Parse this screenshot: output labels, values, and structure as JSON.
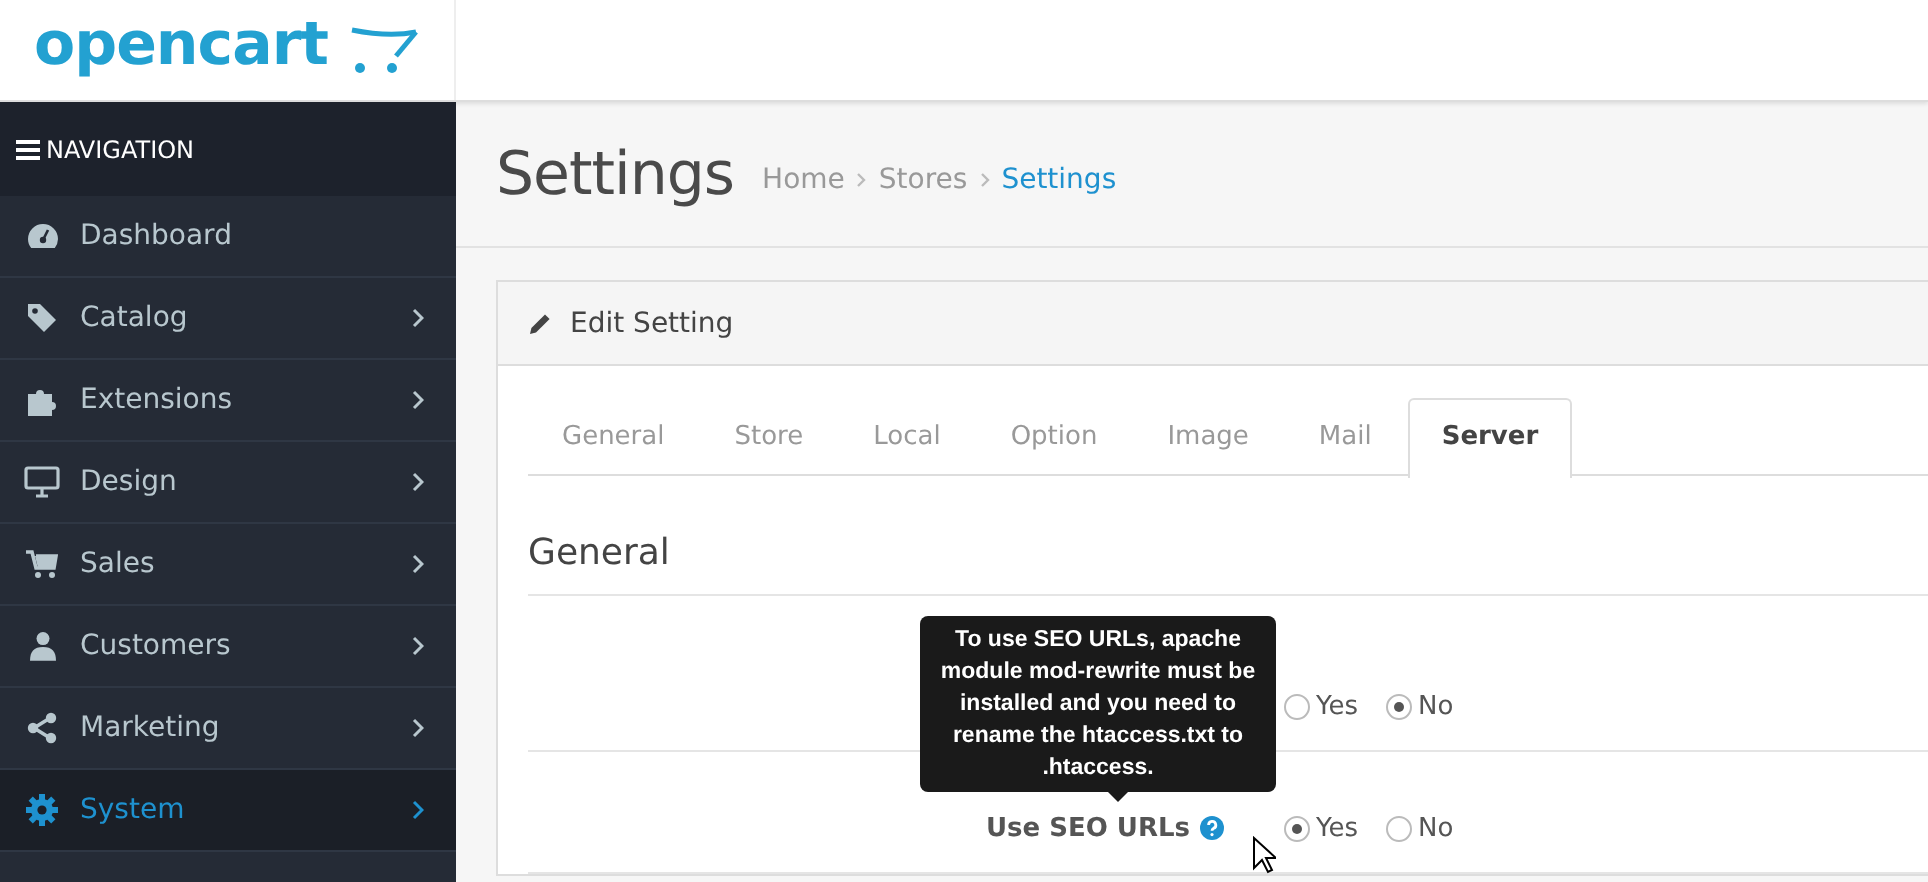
{
  "logo": {
    "text": "opencart"
  },
  "navigation": {
    "title": "NAVIGATION",
    "items": [
      {
        "label": "Dashboard",
        "has_submenu": false,
        "selected": false
      },
      {
        "label": "Catalog",
        "has_submenu": true,
        "selected": false
      },
      {
        "label": "Extensions",
        "has_submenu": true,
        "selected": false
      },
      {
        "label": "Design",
        "has_submenu": true,
        "selected": false
      },
      {
        "label": "Sales",
        "has_submenu": true,
        "selected": false
      },
      {
        "label": "Customers",
        "has_submenu": true,
        "selected": false
      },
      {
        "label": "Marketing",
        "has_submenu": true,
        "selected": false
      },
      {
        "label": "System",
        "has_submenu": true,
        "selected": true
      }
    ]
  },
  "page": {
    "title": "Settings",
    "breadcrumb": [
      {
        "label": "Home",
        "selected": false
      },
      {
        "label": "Stores",
        "selected": false
      },
      {
        "label": "Settings",
        "selected": true
      }
    ]
  },
  "panel": {
    "title": "Edit Setting",
    "tabs": [
      {
        "label": "General",
        "selected": false
      },
      {
        "label": "Store",
        "selected": false
      },
      {
        "label": "Local",
        "selected": false
      },
      {
        "label": "Option",
        "selected": false
      },
      {
        "label": "Image",
        "selected": false
      },
      {
        "label": "Mail",
        "selected": false
      },
      {
        "label": "Server",
        "selected": true
      }
    ],
    "section": "General",
    "rows": [
      {
        "options": [
          {
            "label": "Yes",
            "selected": false
          },
          {
            "label": "No",
            "selected": true
          }
        ]
      },
      {
        "label": "Use SEO URLs",
        "options": [
          {
            "label": "Yes",
            "selected": true
          },
          {
            "label": "No",
            "selected": false
          }
        ]
      }
    ],
    "tooltip": {
      "text": "To use SEO URLs, apache module mod-rewrite must be installed and you need to rename the htaccess.txt to .htaccess."
    }
  }
}
